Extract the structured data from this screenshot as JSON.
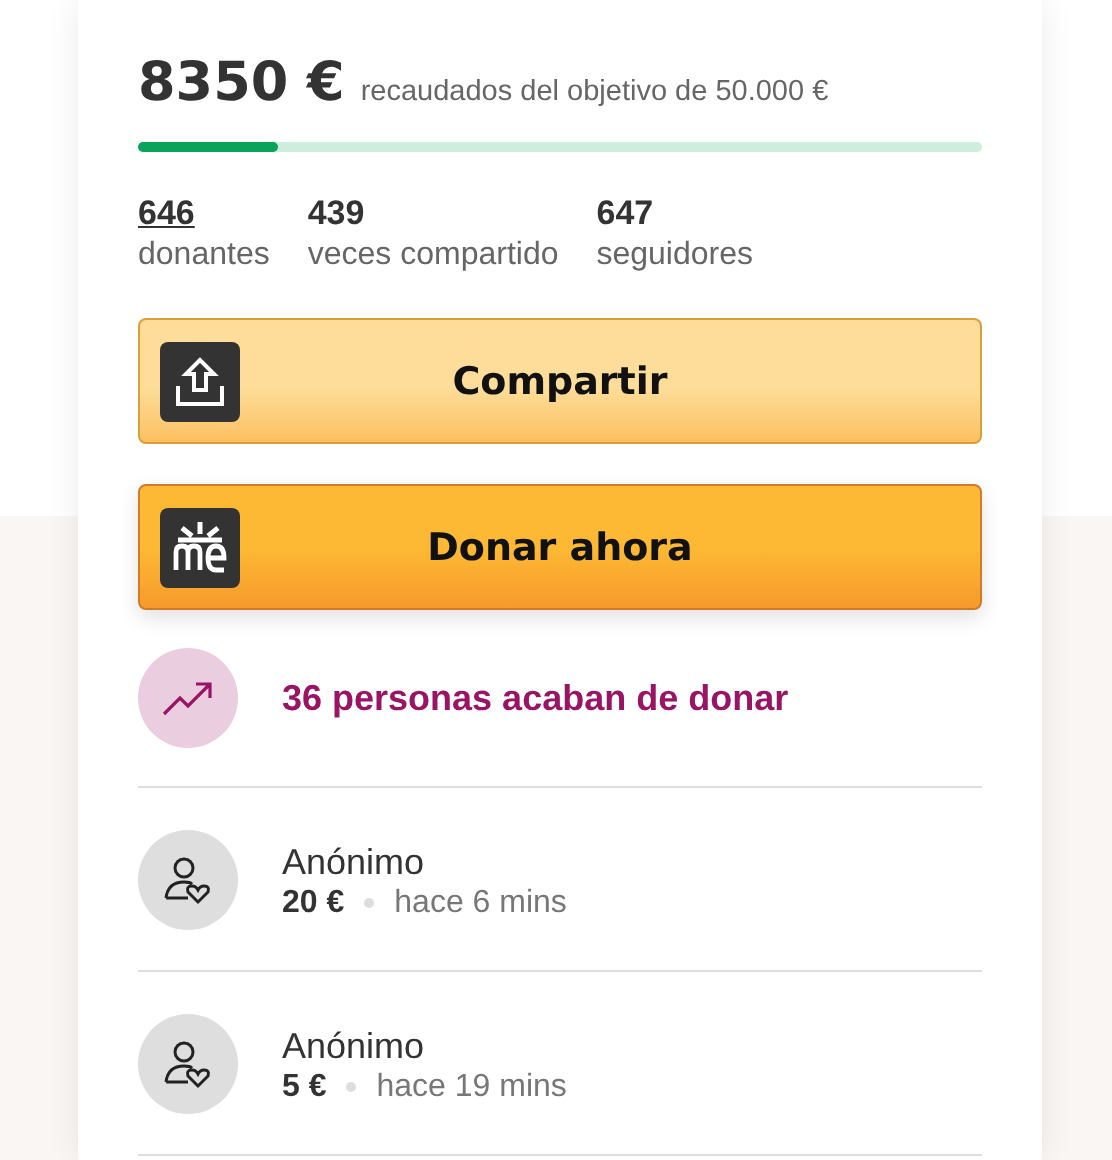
{
  "raised": {
    "amount": "8350 €",
    "goal_text": "recaudados del objetivo de 50.000 €",
    "level": 0.167
  },
  "stats": [
    {
      "value": "646",
      "label": "donantes",
      "link": true
    },
    {
      "value": "439",
      "label": "veces compartido",
      "link": false
    },
    {
      "value": "647",
      "label": "seguidores",
      "link": false
    }
  ],
  "buttons": [
    {
      "kind": "share",
      "label": "Compartir"
    },
    {
      "kind": "donate",
      "label": "Donar ahora"
    }
  ],
  "activity": {
    "text": "36 personas acaban de donar"
  },
  "donations": [
    {
      "name": "Anónimo",
      "amount": "20 €",
      "time": "hace 6 mins"
    },
    {
      "name": "Anónimo",
      "amount": "5 €",
      "time": "hace 19 mins"
    }
  ]
}
